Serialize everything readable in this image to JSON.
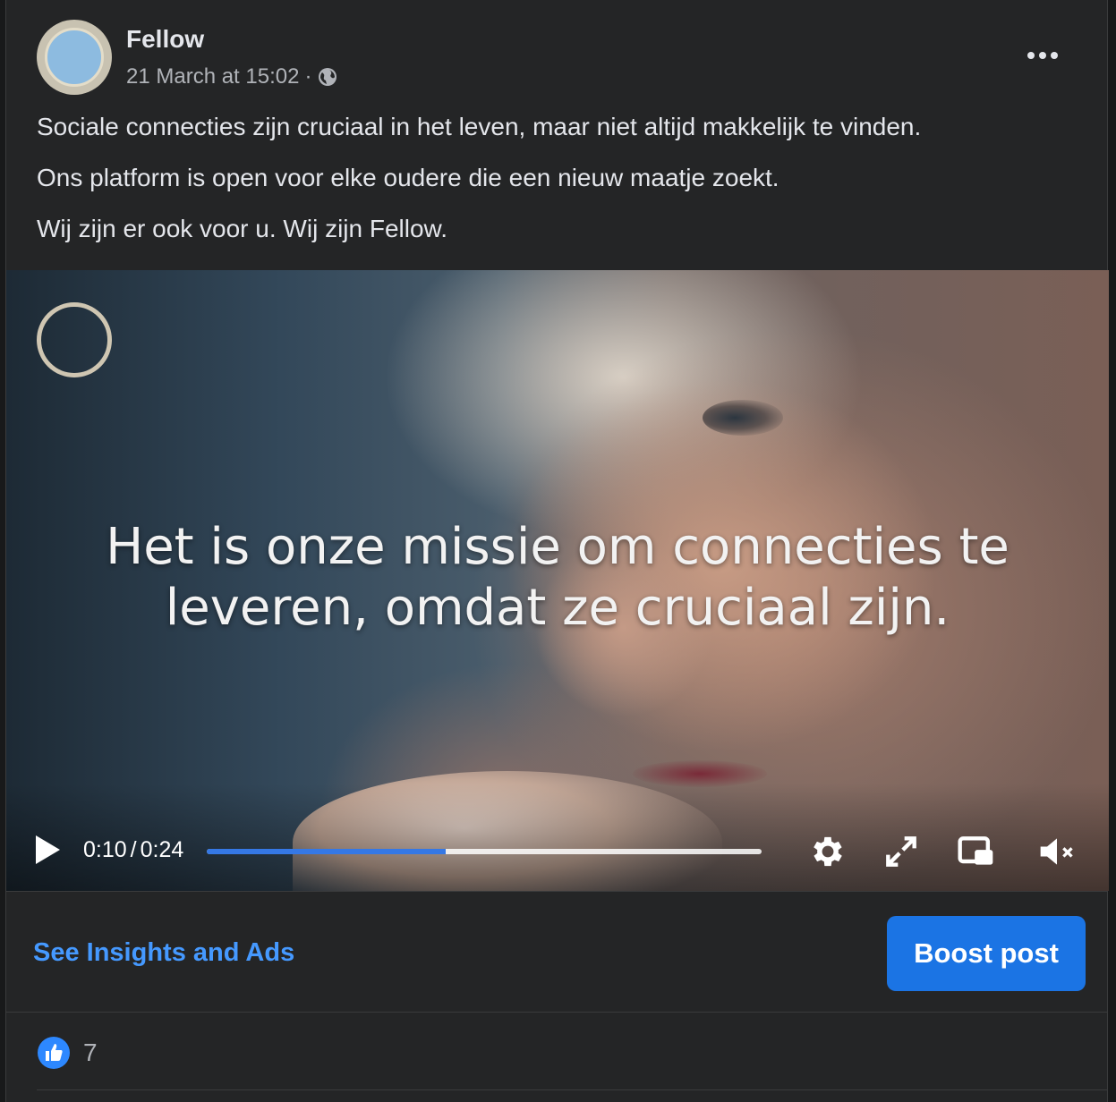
{
  "post": {
    "page_name": "Fellow",
    "timestamp": "21 March at 15:02",
    "separator": "·",
    "audience_icon": "globe-icon",
    "more_icon": "more-options-icon",
    "text": [
      "Sociale connecties zijn cruciaal in het leven, maar niet altijd makkelijk te vinden.",
      "Ons platform is open voor elke oudere die een nieuw maatje zoekt.",
      "Wij zijn er ook voor u. Wij zijn Fellow."
    ]
  },
  "video": {
    "caption_line1": "Het is onze missie om connecties te",
    "caption_line2": "leveren, omdat ze cruciaal zijn.",
    "current_time": "0:10",
    "time_separator": "/",
    "duration": "0:24",
    "progress": 0.43,
    "icons": [
      "play-icon",
      "settings-icon",
      "fullscreen-icon",
      "picture-in-picture-icon",
      "muted-volume-icon"
    ]
  },
  "actions": {
    "insights_label": "See Insights and Ads",
    "boost_label": "Boost post"
  },
  "reactions": {
    "count": "7",
    "icon": "like-icon"
  },
  "colors": {
    "accent": "#1b74e4",
    "link": "#4599ff",
    "progress": "#3578e5",
    "card_bg": "#242526"
  }
}
